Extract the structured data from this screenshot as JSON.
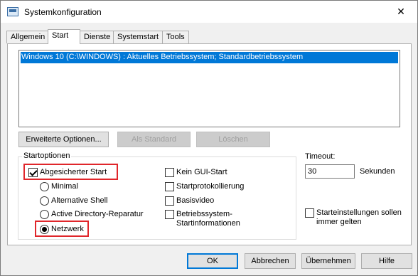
{
  "window": {
    "title": "Systemkonfiguration",
    "close_glyph": "✕"
  },
  "tabs": [
    {
      "label": "Allgemein",
      "active": false
    },
    {
      "label": "Start",
      "active": true
    },
    {
      "label": "Dienste",
      "active": false
    },
    {
      "label": "Systemstart",
      "active": false
    },
    {
      "label": "Tools",
      "active": false
    }
  ],
  "os_list": {
    "items": [
      "Windows 10 (C:\\WINDOWS) : Aktuelles Betriebssystem; Standardbetriebssystem"
    ],
    "selected_index": 0
  },
  "list_buttons": {
    "advanced": "Erweiterte Optionen...",
    "set_default": "Als Standard",
    "delete": "Löschen"
  },
  "boot_options": {
    "group_label": "Startoptionen",
    "safe_boot": {
      "label": "Abgesicherter Start",
      "checked": true
    },
    "modes": [
      {
        "label": "Minimal",
        "checked": false
      },
      {
        "label": "Alternative Shell",
        "checked": false
      },
      {
        "label": "Active Directory-Reparatur",
        "checked": false
      },
      {
        "label": "Netzwerk",
        "checked": true
      }
    ],
    "no_gui": {
      "label": "Kein GUI-Start",
      "checked": false
    },
    "boot_log": {
      "label": "Startprotokollierung",
      "checked": false
    },
    "base_video": {
      "label": "Basisvideo",
      "checked": false
    },
    "os_boot_info": {
      "label_line1": "Betriebssystem-",
      "label_line2": "Startinformationen",
      "checked": false
    }
  },
  "timeout": {
    "label": "Timeout:",
    "value": "30",
    "unit": "Sekunden"
  },
  "make_permanent": {
    "label_line1": "Starteinstellungen sollen",
    "label_line2": "immer gelten",
    "checked": false
  },
  "footer": {
    "ok": "OK",
    "cancel": "Abbrechen",
    "apply": "Übernehmen",
    "help": "Hilfe"
  },
  "colors": {
    "selection": "#0078d7",
    "highlight_box": "#e0262b"
  }
}
